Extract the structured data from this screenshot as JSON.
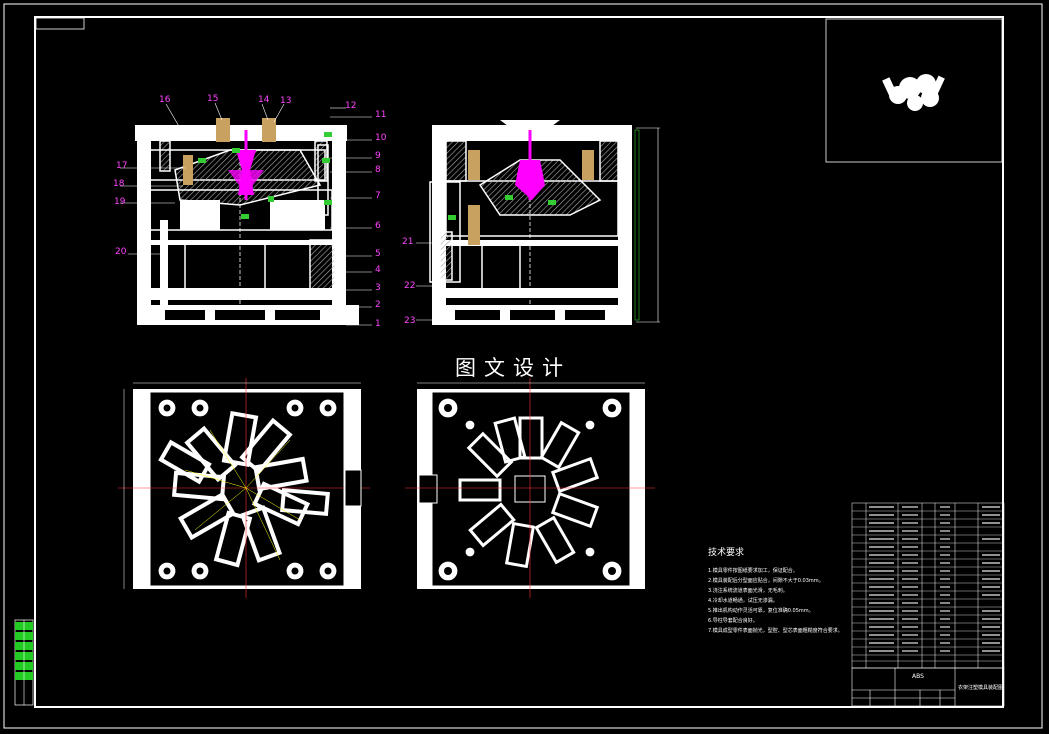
{
  "drawing": {
    "title_watermark": "图文设计",
    "tech_requirements_title": "技术要求",
    "tech_notes": [
      "1.模具零件按图纸要求加工，保证配合。",
      "2.模具装配后分型面应贴合，间隙不大于0.03mm。",
      "3.浇注系统流道表面光滑，无毛刺。",
      "4.冷却水道畅通，试压无渗漏。",
      "5.推出机构动作灵活可靠，复位准确0.05mm。",
      "6.导柱导套配合良好。",
      "7.模具成型零件表面抛光，型腔、型芯表面粗糙度符合要求。"
    ],
    "part_numbers_left": [
      "1",
      "2",
      "3",
      "4",
      "5",
      "6",
      "7",
      "8",
      "9",
      "10",
      "11",
      "12"
    ],
    "part_numbers_top": [
      "16",
      "15",
      "14",
      "13"
    ],
    "part_numbers_side": [
      "17",
      "18",
      "19",
      "20"
    ],
    "part_numbers_right_view": [
      "21",
      "22",
      "23"
    ],
    "material": "ABS",
    "title_block_name": "衣架注塑模具装配图",
    "colors": {
      "background": "#000000",
      "lines": "#ffffff",
      "leader_labels": "#ff44ff",
      "sprue": "#ff00ff",
      "insert": "#c8a060",
      "green_marks": "#33cc33",
      "border": "#ffffff"
    }
  }
}
